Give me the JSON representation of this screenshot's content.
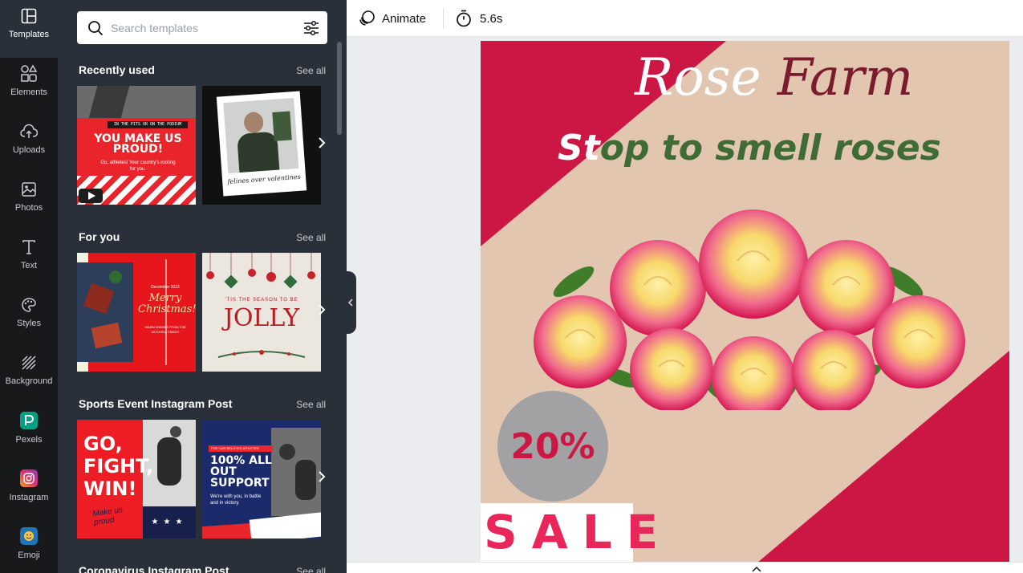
{
  "rail": {
    "items": [
      {
        "label": "Templates",
        "icon": "templates-icon"
      },
      {
        "label": "Elements",
        "icon": "elements-icon"
      },
      {
        "label": "Uploads",
        "icon": "uploads-icon"
      },
      {
        "label": "Photos",
        "icon": "photos-icon"
      },
      {
        "label": "Text",
        "icon": "text-icon"
      },
      {
        "label": "Styles",
        "icon": "styles-icon"
      },
      {
        "label": "Background",
        "icon": "background-icon"
      },
      {
        "label": "Pexels",
        "icon": "pexels-icon"
      },
      {
        "label": "Instagram",
        "icon": "instagram-icon"
      },
      {
        "label": "Emoji",
        "icon": "emoji-icon"
      }
    ]
  },
  "search": {
    "placeholder": "Search templates"
  },
  "sections": [
    {
      "title": "Recently used",
      "see_all": "See all",
      "tiles": [
        {
          "line1": "IN THE PITS OR ON THE PODIUM",
          "headline": "YOU MAKE US PROUD!",
          "body": "Go, athletes! Your country's rooting for you."
        },
        {
          "caption": "felines over valentines"
        }
      ]
    },
    {
      "title": "For you",
      "see_all": "See all",
      "tiles": [
        {
          "small": "December 2022",
          "script": "Merry Christmas!",
          "footer": "WARM WISHES FROM THE MITCHELL FAMILY"
        },
        {
          "small": "'TIS THE SEASON TO BE",
          "big": "JOLLY"
        }
      ]
    },
    {
      "title": "Sports Event Instagram Post",
      "see_all": "See all",
      "tiles": [
        {
          "headline": "GO, FIGHT, WIN!",
          "script": "Make us proud"
        },
        {
          "tag": "FOR OUR BELOVED ATHLETES",
          "headline": "100% ALL OUT SUPPORT",
          "body": "We're with you, in battle and in victory."
        }
      ]
    },
    {
      "title": "Coronavirus Instagram Post",
      "see_all": "See all"
    }
  ],
  "topbar": {
    "animate": "Animate",
    "duration": "5.6s"
  },
  "design": {
    "title_part1": "Rose",
    "title_part2": "Farm",
    "subtitle_part1": "St",
    "subtitle_part2": "op to smell roses",
    "discount": "20%",
    "sale": "SALE",
    "colors": {
      "crimson": "#cc1744",
      "beige": "#e2c6b0",
      "green": "#3f6b34",
      "maroon": "#7a1c2e",
      "grey": "#9e9e9e"
    }
  }
}
